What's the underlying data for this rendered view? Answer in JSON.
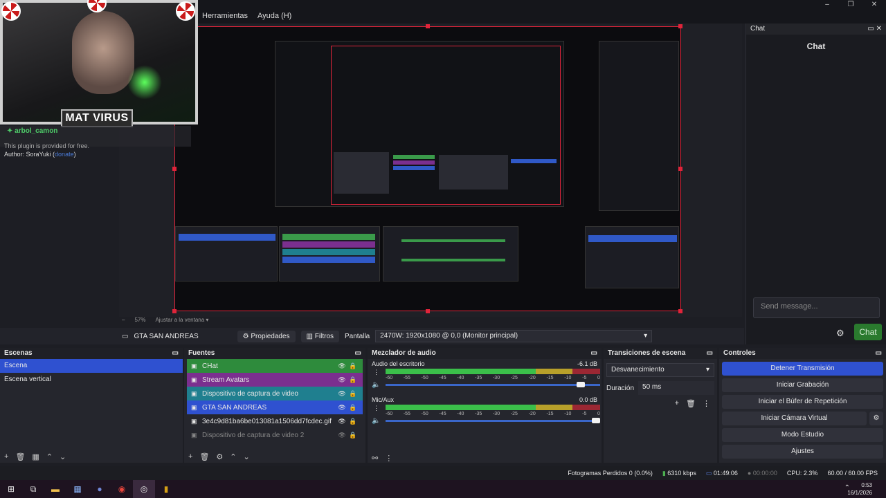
{
  "menu": [
    "Herramientas",
    "Ayuda (H)"
  ],
  "window_controls": [
    "–",
    "❐",
    "✕"
  ],
  "webcam": {
    "name": "MAT VIRUS"
  },
  "chat_overlay": {
    "username": "arbol_camon",
    "message": "This plugin is provided for free.",
    "author_prefix": "Author: SoraYuki (",
    "author_link": "donate",
    "author_suffix": ")"
  },
  "zoom": {
    "level": "57%",
    "fit_label": "Ajustar a la ventana"
  },
  "context_bar": {
    "source_name": "GTA SAN ANDREAS",
    "properties": "Propiedades",
    "filters": "Filtros",
    "display_label": "Pantalla",
    "display_value": "2470W: 1920x1080 @ 0,0 (Monitor principal)"
  },
  "chat_dock": {
    "header": "Chat",
    "title": "Chat",
    "placeholder": "Send message...",
    "send_label": "Chat"
  },
  "scenes": {
    "title": "Escenas",
    "items": [
      "Escena",
      "Escena vertical"
    ]
  },
  "sources": {
    "title": "Fuentes",
    "items": [
      {
        "label": "CHat",
        "bg": "#2e8b3c"
      },
      {
        "label": "Stream Avatars",
        "bg": "#7b2f8f"
      },
      {
        "label": "Dispositivo de captura de video",
        "bg": "#1f7f8f"
      },
      {
        "label": "GTA SAN ANDREAS",
        "bg": "#2f51d0"
      },
      {
        "label": "3e4c9d81ba6be013081a1506dd7fcdec.gif",
        "bg": ""
      },
      {
        "label": "Dispositivo de captura de video 2",
        "bg": ""
      }
    ]
  },
  "mixer": {
    "title": "Mezclador de audio",
    "ticks": [
      "-60",
      "-55",
      "-50",
      "-45",
      "-40",
      "-35",
      "-30",
      "-25",
      "-20",
      "-15",
      "-10",
      "-5",
      "0"
    ],
    "channels": [
      {
        "name": "Audio del escritorio",
        "db": "-6.1 dB",
        "level": 0.93
      },
      {
        "name": "Mic/Aux",
        "db": "0.0 dB",
        "level": 1.0
      }
    ]
  },
  "transitions": {
    "title": "Transiciones de escena",
    "selected": "Desvanecimiento",
    "duration_label": "Duración",
    "duration_value": "50 ms"
  },
  "controls": {
    "title": "Controles",
    "buttons": [
      "Detener Transmisión",
      "Iniciar Grabación",
      "Iniciar el Búfer de Repetición",
      "Iniciar Cámara Virtual",
      "Modo Estudio",
      "Ajustes"
    ]
  },
  "status": {
    "dropped": "Fotogramas Perdidos 0 (0.0%)",
    "bitrate": "6310 kbps",
    "live_time": "01:49:06",
    "rec_time": "00:00:00",
    "cpu": "CPU: 2.3%",
    "fps": "60.00 / 60.00 FPS"
  },
  "taskbar": {
    "time": "0:53",
    "date": "16/1/2026"
  },
  "colors": {
    "accent": "#2f51d0",
    "preview_border": "#e0243a",
    "chat_button": "#2a7a2e"
  }
}
